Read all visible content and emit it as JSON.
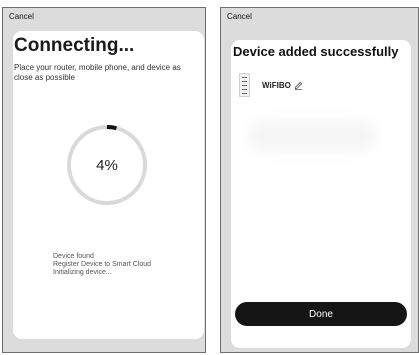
{
  "connecting_screen": {
    "cancel_label": "Cancel",
    "title": "Connecting...",
    "hint": "Place your router, mobile phone, and device as close as possible",
    "progress_percent": 4,
    "progress_text": "4%",
    "steps": [
      "Device found",
      "Register Device to Smart Cloud",
      "Initializing device..."
    ]
  },
  "success_screen": {
    "cancel_label": "Cancel",
    "title": "Device added successfully",
    "device_name": "WiFIBO",
    "device_icon": "device-thumbnail-icon",
    "edit_icon": "pencil-icon",
    "done_label": "Done"
  },
  "colors": {
    "background": "#dcdcdc",
    "card": "#ffffff",
    "progress_track": "#d9d9d9",
    "progress_fill": "#111111",
    "button": "#151515",
    "button_text": "#ffffff"
  }
}
